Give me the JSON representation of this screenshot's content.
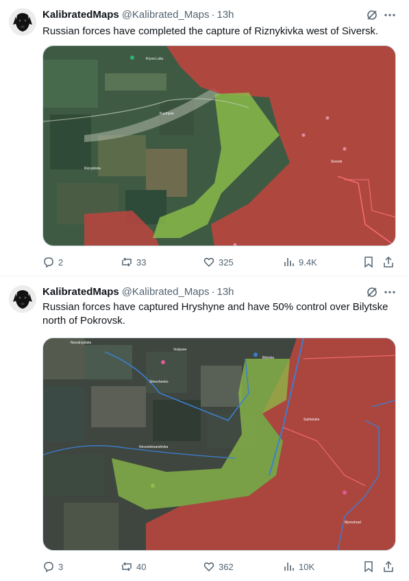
{
  "tweets": [
    {
      "author": {
        "name": "KalibratedMaps",
        "handle": "@Kalibrated_Maps",
        "time": "13h"
      },
      "text": "Russian forces have completed the capture of Riznykivka west of Siversk.",
      "stats": {
        "replies": "2",
        "reposts": "33",
        "likes": "325",
        "views": "9.4K"
      }
    },
    {
      "author": {
        "name": "KalibratedMaps",
        "handle": "@Kalibrated_Maps",
        "time": "13h"
      },
      "text_line1": "Russian forces have captured Hryshyne and have 50% control over Bilytske",
      "text_line2": "north of Pokrovsk.",
      "stats": {
        "replies": "3",
        "reposts": "40",
        "likes": "362",
        "views": "10K"
      }
    }
  ],
  "icons": {
    "verify": "grok-icon",
    "more": "more-dots-icon",
    "reply": "reply-icon",
    "repost": "repost-icon",
    "like": "heart-icon",
    "views": "views-bar-icon",
    "bookmark": "bookmark-icon",
    "share": "share-icon"
  },
  "colors": {
    "russian_control": "#c0453f",
    "ukrainian_advance": "#8dbf4a",
    "frontline_blue": "#3b7fd1",
    "muted_text": "#536471"
  }
}
